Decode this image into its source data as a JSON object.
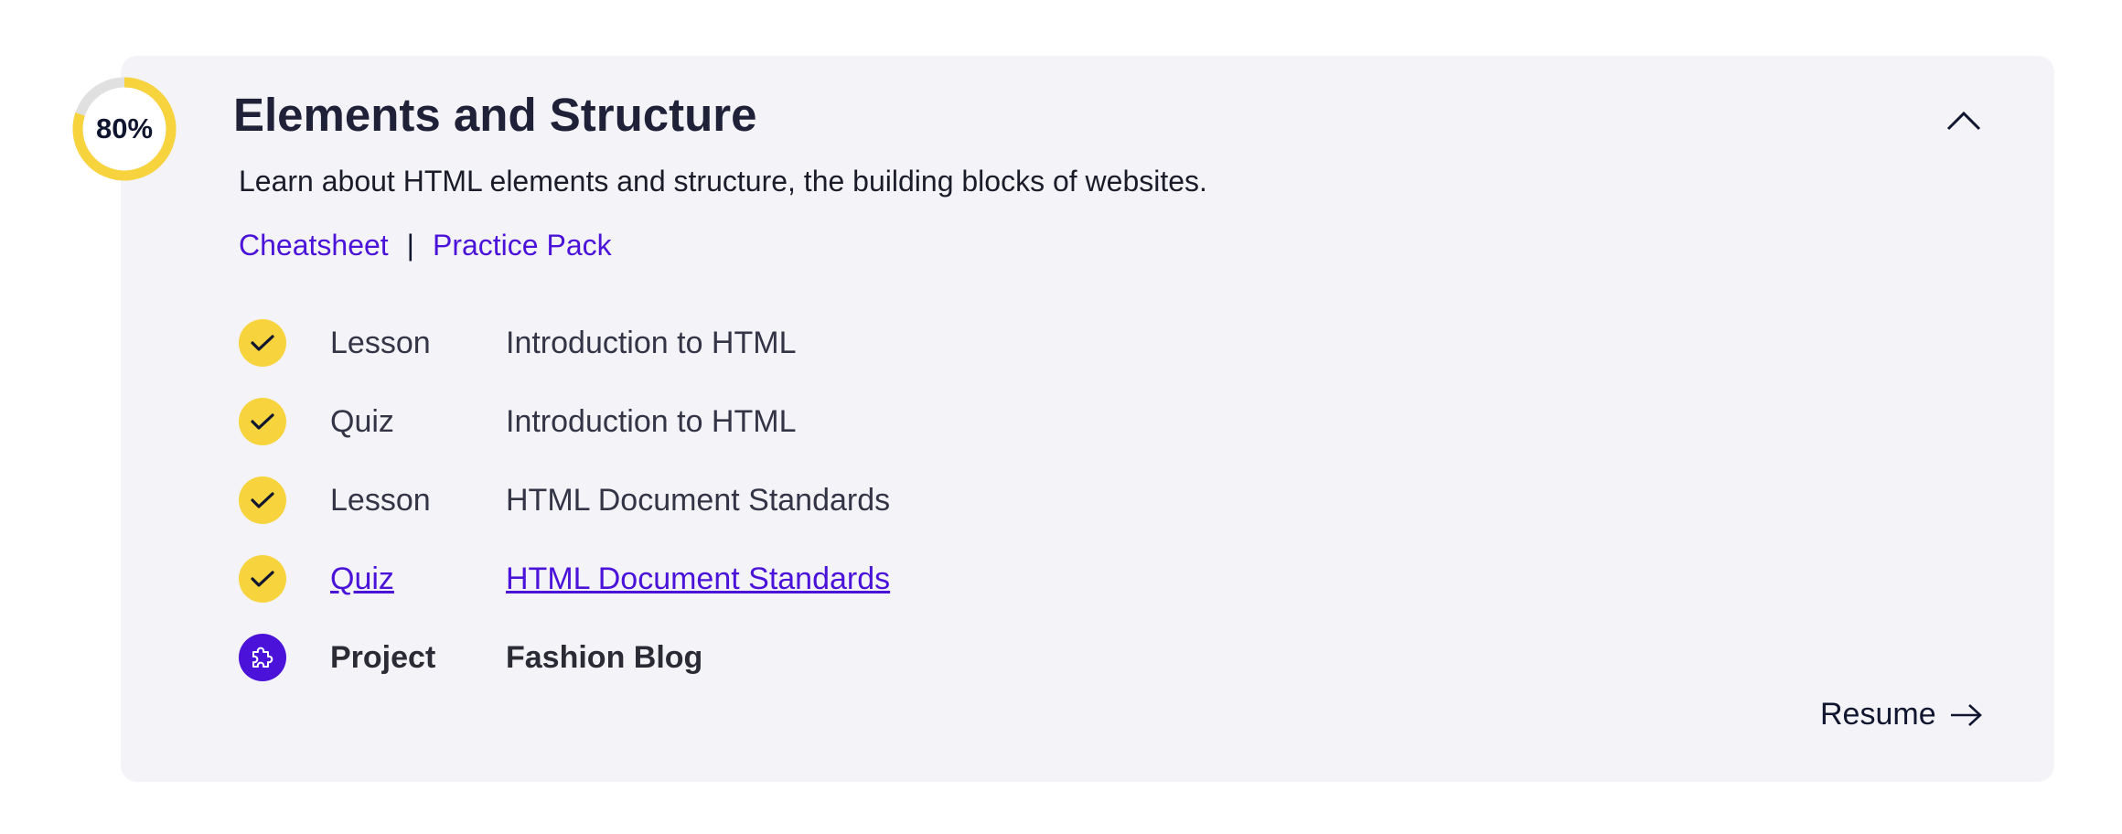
{
  "module": {
    "progress_percent": 80,
    "progress_label": "80%",
    "title": "Elements and Structure",
    "description": "Learn about HTML elements and structure, the building blocks of websites.",
    "resources": [
      {
        "label": "Cheatsheet"
      },
      {
        "label": "Practice Pack"
      }
    ],
    "resource_separator": "|",
    "collapse_icon": "chevron-up-icon",
    "items": [
      {
        "type": "Lesson",
        "name": "Introduction to HTML",
        "status": "completed",
        "icon": "check-icon"
      },
      {
        "type": "Quiz",
        "name": "Introduction to HTML",
        "status": "completed",
        "icon": "check-icon"
      },
      {
        "type": "Lesson",
        "name": "HTML Document Standards",
        "status": "completed",
        "icon": "check-icon"
      },
      {
        "type": "Quiz",
        "name": "HTML Document Standards",
        "status": "completed",
        "icon": "check-icon"
      },
      {
        "type": "Project",
        "name": "Fashion Blog",
        "status": "current",
        "icon": "puzzle-icon"
      }
    ],
    "resume_label": "Resume",
    "resume_icon": "arrow-right-icon"
  },
  "colors": {
    "accent_yellow": "#f7d33e",
    "link_purple": "#4b12d9",
    "card_background": "#f4f4f8",
    "ring_track": "#e0e0e0",
    "text_dark": "#10162f"
  }
}
